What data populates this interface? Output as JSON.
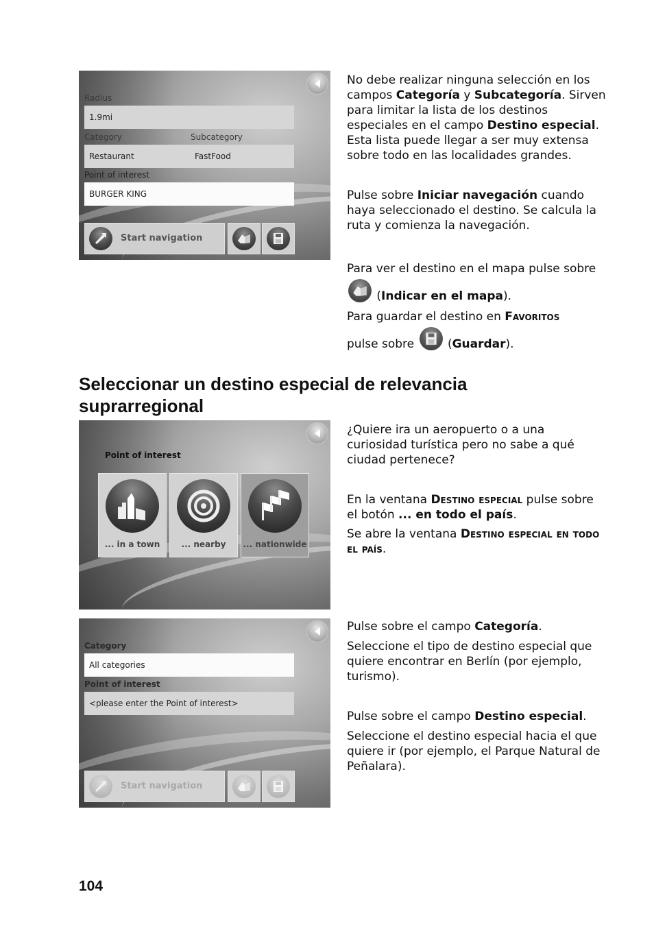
{
  "page": {
    "number": "104",
    "heading": "Seleccionar un destino especial de relevancia suprarregional"
  },
  "screen1": {
    "radius_label": "Radius",
    "radius_value": "1.9mi",
    "category_label": "Category",
    "subcategory_label": "Subcategory",
    "category_value": "Restaurant",
    "subcategory_value": "FastFood",
    "poi_label": "Point of interest",
    "poi_value": "BURGER KING",
    "start_nav_label": "Start navigation",
    "icons": [
      "back-arrow-icon",
      "navigation-arrow-icon",
      "map-icon",
      "save-disk-icon"
    ]
  },
  "screen2": {
    "title": "Point of interest",
    "tiles": [
      {
        "label": "... in a town",
        "icon": "city-icon",
        "selected": false
      },
      {
        "label": "... nearby",
        "icon": "target-icon",
        "selected": false
      },
      {
        "label": "... nationwide",
        "icon": "flags-icon",
        "selected": true
      }
    ]
  },
  "screen3": {
    "category_label": "Category",
    "category_value": "All categories",
    "poi_label": "Point of interest",
    "poi_placeholder": "<please enter the Point of interest>",
    "start_nav_label": "Start navigation",
    "buttons_disabled": true
  },
  "text": {
    "block1": {
      "p1_a": "No debe realizar ninguna selección en los campos ",
      "p1_b1": "Categoría",
      "p1_c": " y ",
      "p1_b2": "Subcategoría",
      "p1_d": ". Sirven para limitar la lista de los destinos especiales en el campo ",
      "p1_b3": "Destino especial",
      "p1_e": ". Esta lista puede llegar a ser muy extensa sobre todo en las localidades grandes.",
      "p2_a": "Pulse sobre ",
      "p2_b": "Iniciar navegación",
      "p2_c": " cuando haya seleccionado el destino. Se calcula la ruta y comienza la navegación.",
      "p3_a": "Para ver el destino en el mapa pulse sobre ",
      "p3_b": "Indicar en el mapa",
      "p4_a": "Para guardar el destino en ",
      "p4_sc": "Favoritos",
      "p4_c": " pulse sobre ",
      "p4_b": "Guardar"
    },
    "block2": {
      "p1": "¿Quiere ira un aeropuerto o a una curiosidad turística pero no sabe a qué ciudad pertenece?",
      "p2_a": "En la ventana ",
      "p2_sc": "Destino especial",
      "p2_c": " pulse sobre el botón ",
      "p2_b": "... en todo el país",
      "p3_a": "Se abre la ventana ",
      "p3_sc": "Destino especial en todo el país"
    },
    "block3": {
      "p1_a": "Pulse sobre el campo ",
      "p1_b": "Categoría",
      "p2": "Seleccione el tipo de destino especial que quiere encontrar en Berlín (por ejemplo, turismo).",
      "p3_a": "Pulse sobre el campo ",
      "p3_b": "Destino especial",
      "p4": "Seleccione el destino especial hacia el que quiere ir (por ejemplo, el Parque Natural de Peñalara)."
    }
  }
}
